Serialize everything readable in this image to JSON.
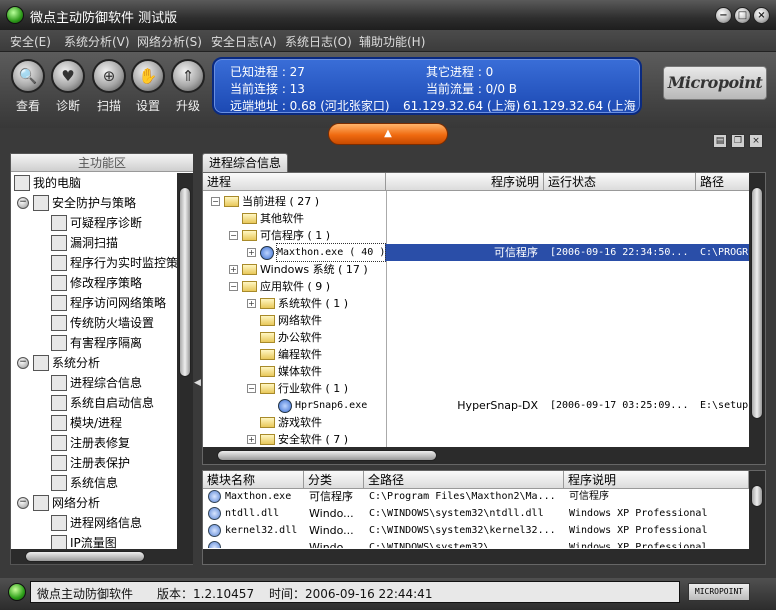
{
  "window": {
    "title": "微点主动防御软件  测试版"
  },
  "menu": [
    "安全(E)",
    "系统分析(V)",
    "网络分析(S)",
    "安全日志(A)",
    "系统日志(O)",
    "辅助功能(H)"
  ],
  "toolbar": [
    {
      "label": "查看",
      "icon": "magnifier-icon"
    },
    {
      "label": "诊断",
      "icon": "heart-icon"
    },
    {
      "label": "扫描",
      "icon": "scan-icon"
    },
    {
      "label": "设置",
      "icon": "hand-icon"
    },
    {
      "label": "升级",
      "icon": "upgrade-arrow-icon"
    }
  ],
  "status": {
    "known_processes": "已知进程 : 27",
    "other_processes": "其它进程 : 0",
    "current_connections": "当前连接 : 13",
    "current_traffic": "当前流量 : 0/0 B",
    "remote_address": "远端地址 : 0.68 (河北张家口)",
    "remote_1": "61.129.32.64 (上海)",
    "remote_2": "61.129.32.64 (上海"
  },
  "logo": "Micropoint",
  "left": {
    "header": "主功能区",
    "tree": [
      {
        "label": "我的电脑",
        "level": 0,
        "icon": "computer-icon"
      },
      {
        "label": "安全防护与策略",
        "level": 1,
        "icon": "shield-policy-icon",
        "toggle": "−"
      },
      {
        "label": "可疑程序诊断",
        "level": 2,
        "icon": "diagnose-icon"
      },
      {
        "label": "漏洞扫描",
        "level": 2,
        "icon": "magnifier-icon"
      },
      {
        "label": "程序行为实时监控策",
        "level": 2,
        "icon": "monitor-icon"
      },
      {
        "label": "修改程序策略",
        "level": 2,
        "icon": "edit-policy-icon"
      },
      {
        "label": "程序访问网络策略",
        "level": 2,
        "icon": "network-policy-icon"
      },
      {
        "label": "传统防火墙设置",
        "level": 2,
        "icon": "firewall-icon"
      },
      {
        "label": "有害程序隔离",
        "level": 2,
        "icon": "quarantine-icon"
      },
      {
        "label": "系统分析",
        "level": 1,
        "icon": "system-icon",
        "toggle": "−"
      },
      {
        "label": "进程综合信息",
        "level": 2,
        "icon": "process-icon"
      },
      {
        "label": "系统自启动信息",
        "level": 2,
        "icon": "startup-icon"
      },
      {
        "label": "模块/进程",
        "level": 2,
        "icon": "module-icon"
      },
      {
        "label": "注册表修复",
        "level": 2,
        "icon": "registry-repair-icon"
      },
      {
        "label": "注册表保护",
        "level": 2,
        "icon": "registry-protect-icon"
      },
      {
        "label": "系统信息",
        "level": 2,
        "icon": "sysinfo-icon"
      },
      {
        "label": "网络分析",
        "level": 1,
        "icon": "network-icon",
        "toggle": "−"
      },
      {
        "label": "进程网络信息",
        "level": 2,
        "icon": "process-network-icon"
      },
      {
        "label": "IP流量图",
        "level": 2,
        "icon": "traffic-chart-icon"
      }
    ]
  },
  "tab": "进程综合信息",
  "process_table": {
    "columns": [
      "进程",
      "程序说明",
      "运行状态",
      "路径"
    ],
    "rows": [
      {
        "label": "当前进程 ( 27 )",
        "indent": 0,
        "toggle": "−",
        "icon": "folder",
        "desc": "",
        "status": "",
        "path": ""
      },
      {
        "label": "其他软件",
        "indent": 1,
        "toggle": "",
        "icon": "folder",
        "desc": "",
        "status": "",
        "path": ""
      },
      {
        "label": "可信程序 ( 1 )",
        "indent": 1,
        "toggle": "−",
        "icon": "folder",
        "desc": "",
        "status": "",
        "path": ""
      },
      {
        "label": "Maxthon.exe ( 40 )",
        "indent": 2,
        "toggle": "+",
        "icon": "app",
        "desc": "可信程序",
        "status": "[2006-09-16 22:34:50...",
        "path": "C:\\PROGR",
        "selected": true
      },
      {
        "label": "Windows 系统 ( 17 )",
        "indent": 1,
        "toggle": "+",
        "icon": "folder",
        "desc": "",
        "status": "",
        "path": ""
      },
      {
        "label": "应用软件 ( 9 )",
        "indent": 1,
        "toggle": "−",
        "icon": "folder",
        "desc": "",
        "status": "",
        "path": ""
      },
      {
        "label": "系统软件 ( 1 )",
        "indent": 2,
        "toggle": "+",
        "icon": "folder",
        "desc": "",
        "status": "",
        "path": ""
      },
      {
        "label": "网络软件",
        "indent": 2,
        "toggle": "",
        "icon": "folder",
        "desc": "",
        "status": "",
        "path": ""
      },
      {
        "label": "办公软件",
        "indent": 2,
        "toggle": "",
        "icon": "folder",
        "desc": "",
        "status": "",
        "path": ""
      },
      {
        "label": "编程软件",
        "indent": 2,
        "toggle": "",
        "icon": "folder",
        "desc": "",
        "status": "",
        "path": ""
      },
      {
        "label": "媒体软件",
        "indent": 2,
        "toggle": "",
        "icon": "folder",
        "desc": "",
        "status": "",
        "path": ""
      },
      {
        "label": "行业软件 ( 1 )",
        "indent": 2,
        "toggle": "−",
        "icon": "folder",
        "desc": "",
        "status": "",
        "path": ""
      },
      {
        "label": "HprSnap6.exe",
        "indent": 3,
        "toggle": "",
        "icon": "app",
        "desc": "HyperSnap-DX",
        "status": "[2006-09-17 03:25:09...",
        "path": "E:\\setup"
      },
      {
        "label": "游戏软件",
        "indent": 2,
        "toggle": "",
        "icon": "folder",
        "desc": "",
        "status": "",
        "path": ""
      },
      {
        "label": "安全软件 ( 7 )",
        "indent": 2,
        "toggle": "+",
        "icon": "folder",
        "desc": "",
        "status": "",
        "path": ""
      }
    ]
  },
  "module_table": {
    "columns": [
      "模块名称",
      "分类",
      "全路径",
      "程序说明"
    ],
    "rows": [
      {
        "name": "Maxthon.exe",
        "type": "可信程序",
        "path": "C:\\Program Files\\Maxthon2\\Ma...",
        "desc": "可信程序"
      },
      {
        "name": "ntdll.dll",
        "type": "Windo...",
        "path": "C:\\WINDOWS\\system32\\ntdll.dll",
        "desc": "Windows XP Professional"
      },
      {
        "name": "kernel32.dll",
        "type": "Windo...",
        "path": "C:\\WINDOWS\\system32\\kernel32...",
        "desc": "Windows XP Professional"
      },
      {
        "name": "...",
        "type": "Windo...",
        "path": "C:\\WINDOWS\\system32\\...",
        "desc": "Windows XP Professional"
      }
    ]
  },
  "statusbar": {
    "app": "微点主动防御软件",
    "version": "版本：1.2.10457",
    "time": "时间：2006-09-16 22:44:41",
    "brand": "MICROPOINT"
  }
}
